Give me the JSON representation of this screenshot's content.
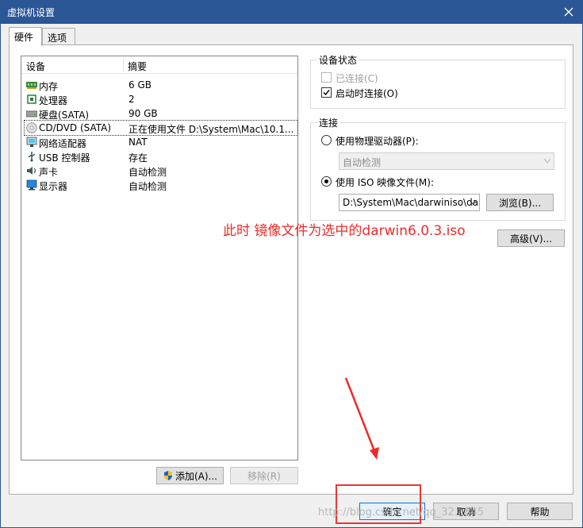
{
  "window": {
    "title": "虚拟机设置"
  },
  "tabs": [
    {
      "label": "硬件"
    },
    {
      "label": "选项"
    }
  ],
  "devices": {
    "col_device": "设备",
    "col_summary": "摘要",
    "rows": [
      {
        "name": "内存",
        "summary": "6 GB",
        "icon": "memory-icon"
      },
      {
        "name": "处理器",
        "summary": "2",
        "icon": "cpu-icon"
      },
      {
        "name": "硬盘(SATA)",
        "summary": "90 GB",
        "icon": "harddisk-icon"
      },
      {
        "name": "CD/DVD (SATA)",
        "summary": "正在使用文件 D:\\System\\Mac\\10.1...",
        "icon": "cd-icon"
      },
      {
        "name": "网络适配器",
        "summary": "NAT",
        "icon": "network-icon"
      },
      {
        "name": "USB 控制器",
        "summary": "存在",
        "icon": "usb-icon"
      },
      {
        "name": "声卡",
        "summary": "自动检测",
        "icon": "sound-icon"
      },
      {
        "name": "显示器",
        "summary": "自动检测",
        "icon": "monitor-icon"
      }
    ]
  },
  "buttons": {
    "add": "添加(A)...",
    "remove": "移除(R)",
    "ok": "确定",
    "cancel": "取消",
    "help": "帮助",
    "browse": "浏览(B)...",
    "advanced": "高级(V)..."
  },
  "device_status": {
    "title": "设备状态",
    "connected": "已连接(C)",
    "connect_on_startup": "启动时连接(O)"
  },
  "connection": {
    "title": "连接",
    "physical_drive": "使用物理驱动器(P):",
    "physical_drive_value": "自动检测",
    "iso_file": "使用 ISO 映像文件(M):",
    "iso_path": "D:\\System\\Mac\\darwiniso\\da"
  },
  "annotation": "此时 镜像文件为选中的darwin6.0.3.iso",
  "watermark": "http://blog.csdn.net/qq_32...845"
}
